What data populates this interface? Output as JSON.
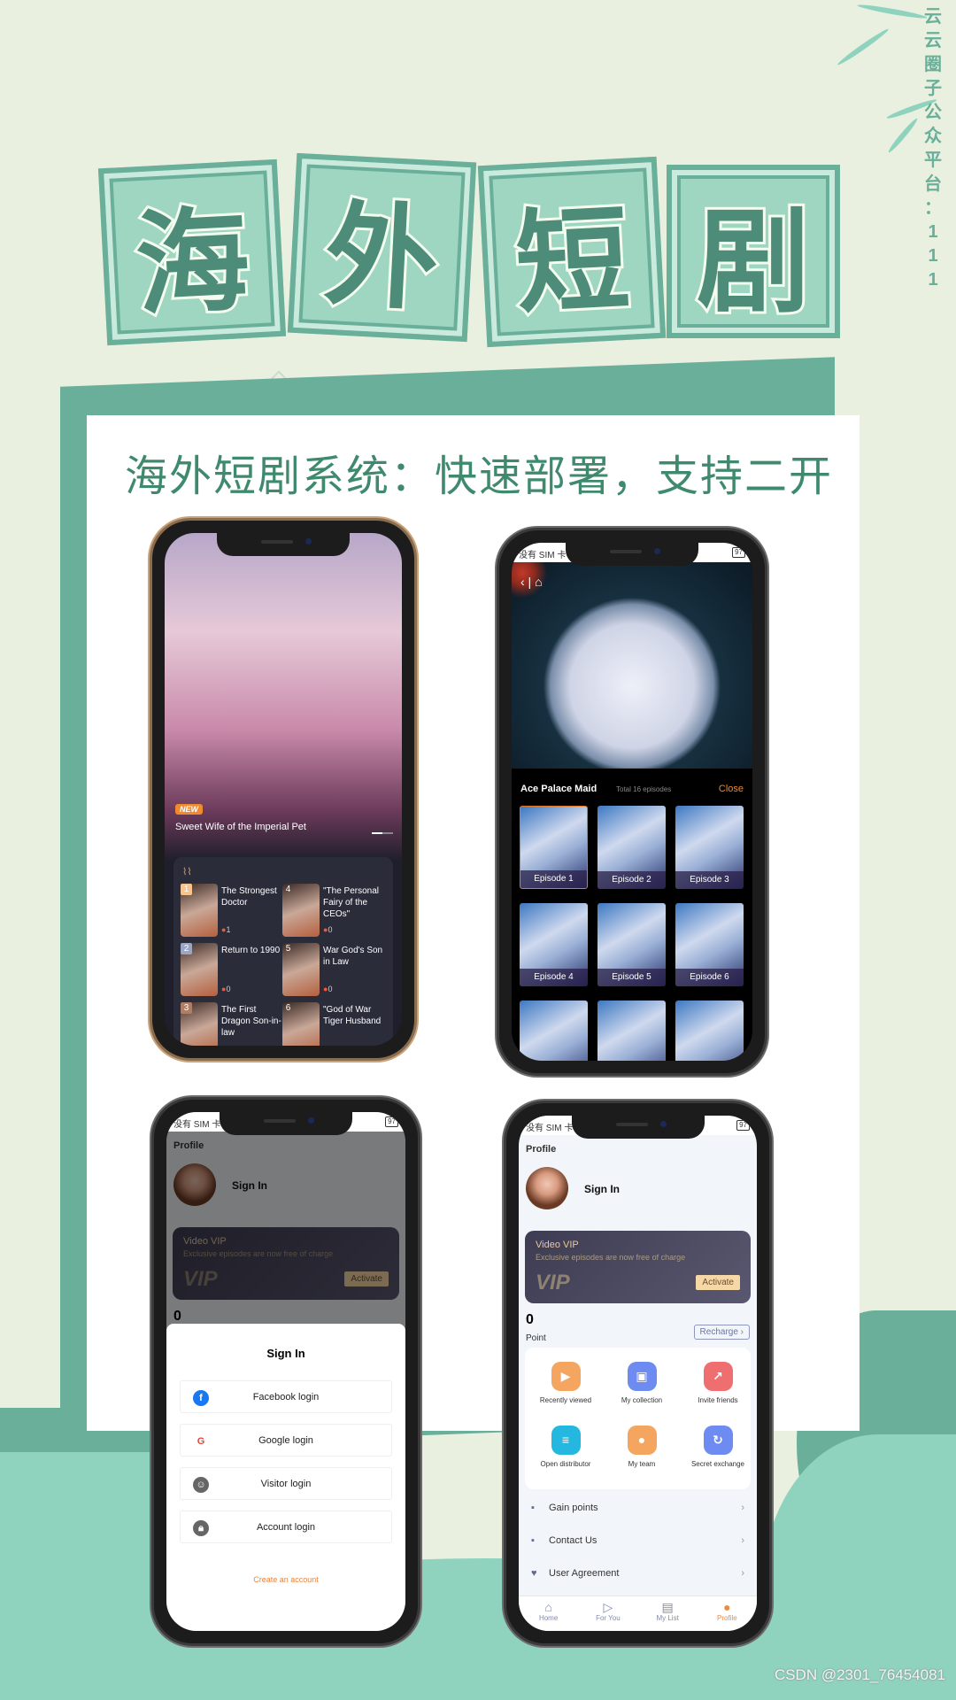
{
  "poster": {
    "title_chars": [
      "海",
      "外",
      "短",
      "剧"
    ],
    "subtitle": "海外短剧系统：快速部署，支持二开",
    "watermark_vertical": [
      "云",
      "云",
      "圈",
      "子",
      "公",
      "众",
      "平",
      "台",
      "：",
      "1",
      "1",
      "1"
    ],
    "csdn_credit": "CSDN @2301_76454081",
    "colors": {
      "background": "#e9f0df",
      "accent_green": "#6aaf9a",
      "light_green": "#9ed6c2",
      "cloud": "#8fd3bf",
      "orange": "#f08a2c"
    }
  },
  "status_bar": {
    "carrier": "没有 SIM 卡 10",
    "battery": "97"
  },
  "home_screen": {
    "banner_badge": "NEW",
    "banner_title": "Sweet Wife of the Imperial Pet",
    "ranking": [
      {
        "rank": "1",
        "title": "The Strongest Doctor",
        "heat": "1"
      },
      {
        "rank": "2",
        "title": "Return to 1990",
        "heat": "0"
      },
      {
        "rank": "3",
        "title": "The First Dragon Son-in-law",
        "heat": ""
      },
      {
        "rank": "4",
        "title": "\"The Personal Fairy of the CEOs\"",
        "heat": "0"
      },
      {
        "rank": "5",
        "title": "War God's Son in Law",
        "heat": "0"
      },
      {
        "rank": "6",
        "title": "\"God of War Tiger Husband",
        "heat": ""
      }
    ]
  },
  "episodes_screen": {
    "drama_title": "Ace Palace Maid",
    "total": "Total 16 episodes",
    "close_label": "Close",
    "episodes": [
      "Episode 1",
      "Episode 2",
      "Episode 3",
      "Episode 4",
      "Episode 5",
      "Episode 6",
      "",
      "",
      ""
    ],
    "selected_episode": 1
  },
  "profile": {
    "page_title": "Profile",
    "sign_in": "Sign In",
    "vip_title": "Video VIP",
    "vip_desc": "Exclusive episodes are now free of charge",
    "vip_logo": "VIP",
    "activate": "Activate",
    "points_value": "0",
    "points_label": "Point",
    "recharge": "Recharge",
    "grid": [
      {
        "label": "Recently viewed",
        "icon": "film-icon",
        "color": "#f4a660"
      },
      {
        "label": "My collection",
        "icon": "calendar-icon",
        "color": "#6d8bf0"
      },
      {
        "label": "Invite friends",
        "icon": "arrow-up-right-icon",
        "color": "#ef6f70"
      },
      {
        "label": "Open distributor",
        "icon": "document-icon",
        "color": "#24b8e0"
      },
      {
        "label": "My team",
        "icon": "person-icon",
        "color": "#f4a660"
      },
      {
        "label": "Secret exchange",
        "icon": "refresh-icon",
        "color": "#6d8bf0"
      }
    ],
    "menu": [
      {
        "label": "Gain points",
        "icon": "chat-icon"
      },
      {
        "label": "Contact Us",
        "icon": "contact-icon"
      },
      {
        "label": "User Agreement",
        "icon": "handshake-icon"
      }
    ],
    "tabs": [
      {
        "label": "Home",
        "icon": "home-icon",
        "active": false
      },
      {
        "label": "For You",
        "icon": "play-icon",
        "active": false
      },
      {
        "label": "My List",
        "icon": "list-icon",
        "active": false
      },
      {
        "label": "Profile",
        "icon": "profile-icon",
        "active": true
      }
    ]
  },
  "signin_sheet": {
    "title": "Sign In",
    "buttons": [
      {
        "label": "Facebook login",
        "icon": "facebook-icon",
        "color": "#1877f2"
      },
      {
        "label": "Google login",
        "icon": "google-icon",
        "color": "#ea4335"
      },
      {
        "label": "Visitor login",
        "icon": "visitor-icon",
        "color": "#666666"
      },
      {
        "label": "Account login",
        "icon": "lock-icon",
        "color": "#666666"
      }
    ],
    "create_account": "Create an account"
  }
}
